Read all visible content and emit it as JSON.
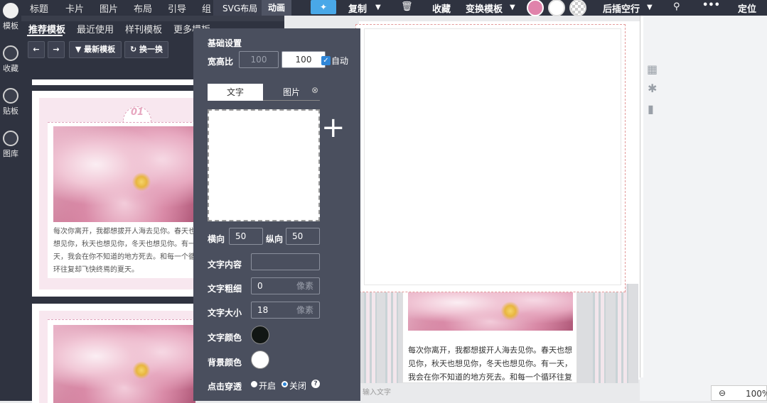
{
  "rail": {
    "items": [
      {
        "label": "模板"
      },
      {
        "label": "收藏"
      },
      {
        "label": "贴板"
      },
      {
        "label": "图库"
      }
    ]
  },
  "topnav": {
    "items": [
      "标题",
      "卡片",
      "图片",
      "布局",
      "引导",
      "组"
    ],
    "svg_layout": "SVG布局",
    "animation": "动画"
  },
  "template_tabs": {
    "items": [
      "推荐模板",
      "最近使用",
      "样刊模板",
      "更多模板"
    ],
    "active": "推荐模板"
  },
  "template_nav": {
    "latest_label": "最新模板",
    "shuffle_label": "换一换"
  },
  "template_cards": [
    {
      "badge": "01",
      "text": "每次你离开，我都想拔开人海去见你。春天也想见你，秋天也想见你，冬天也想见你。有一天，我会在你不知道的地方死去。和每一个循环往复却飞快终焉的夏天。"
    },
    {
      "badge": "",
      "text": ""
    }
  ],
  "toolbar": {
    "copy_label": "复制",
    "favorite_label": "收藏",
    "switch_template_label": "变换模板",
    "insert_after_label": "后插空行",
    "more_label": "•••",
    "locate_label": "定位",
    "colors": [
      "#e083ab",
      "#ffffff"
    ]
  },
  "popup": {
    "section_title": "基础设置",
    "ratio_label": "宽高比",
    "ratio_w_placeholder": "100",
    "ratio_h_value": "100",
    "auto_label": "自动",
    "tabs": [
      "文字",
      "图片"
    ],
    "x_label": "横向",
    "x_value": "50",
    "y_label": "纵向",
    "y_value": "50",
    "text_content_label": "文字内容",
    "text_content_value": "",
    "weight_label": "文字粗细",
    "weight_value": "0",
    "weight_unit": "像素",
    "size_label": "文字大小",
    "size_value": "18",
    "size_unit": "像素",
    "text_color_label": "文字颜色",
    "text_color": "#111614",
    "bg_color_label": "背景颜色",
    "bg_color": "#ffffff",
    "clickthrough_label": "点击穿透",
    "on_label": "开启",
    "off_label": "关闭"
  },
  "canvas": {
    "paragraph": "每次你离开，我都想拔开人海去见你。春天也想见你，秋天也想见你，冬天也想见你。有一天，我会在你不知道的地方死去。和每一个循环往复却飞快终焉的夏",
    "input_hint": "输入文字"
  },
  "zoom": {
    "value": "100%"
  }
}
